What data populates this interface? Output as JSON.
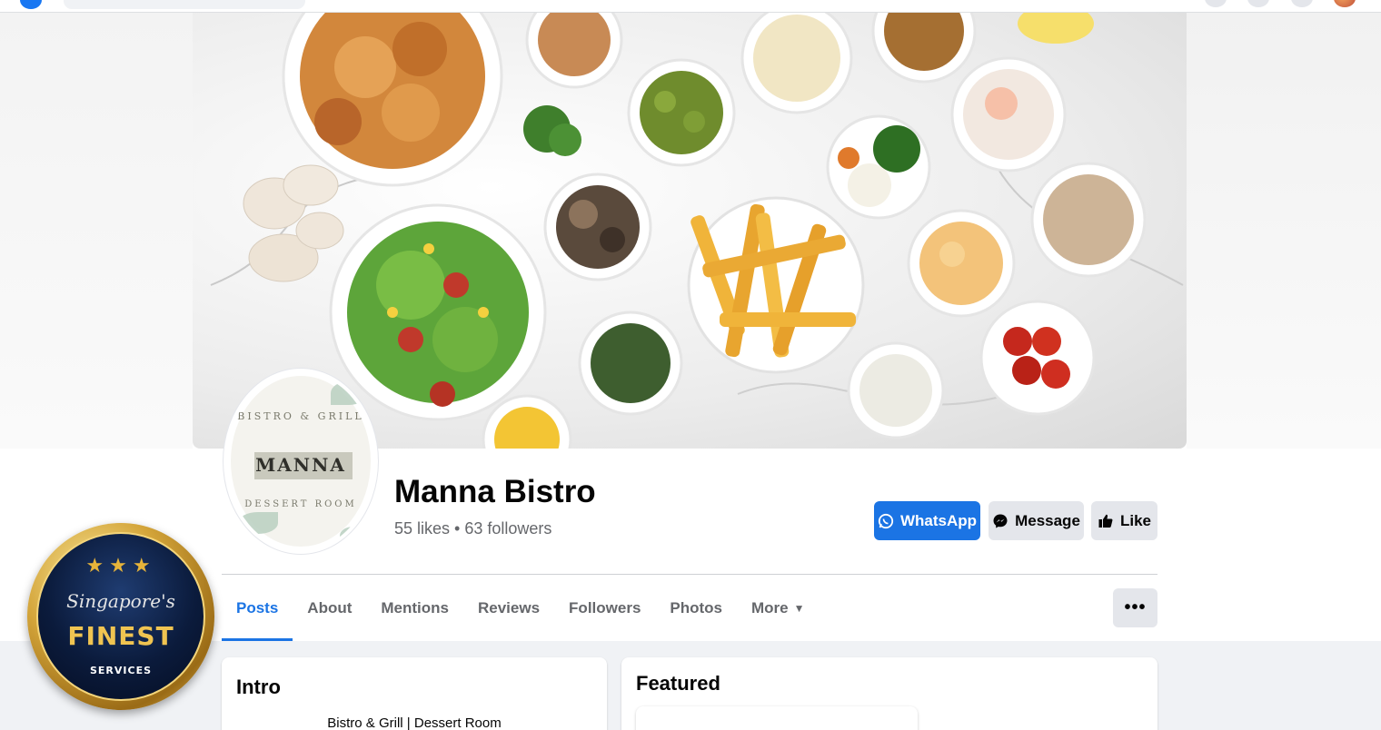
{
  "page": {
    "name": "Manna Bistro",
    "stats": "55 likes • 63 followers"
  },
  "avatar": {
    "ring_top": "BISTRO & GRILL",
    "brand": "MANNA",
    "ring_bottom": "DESSERT ROOM"
  },
  "actions": {
    "whatsapp": "WhatsApp",
    "message": "Message",
    "like": "Like"
  },
  "tabs": [
    {
      "label": "Posts",
      "active": true
    },
    {
      "label": "About",
      "active": false
    },
    {
      "label": "Mentions",
      "active": false
    },
    {
      "label": "Reviews",
      "active": false
    },
    {
      "label": "Followers",
      "active": false
    },
    {
      "label": "Photos",
      "active": false
    },
    {
      "label": "More",
      "active": false
    }
  ],
  "more_menu": "•••",
  "intro": {
    "title": "Intro",
    "description": "Bistro & Grill | Dessert Room"
  },
  "featured": {
    "title": "Featured"
  },
  "badge": {
    "stars": "★★★",
    "line1": "Singapore's",
    "line2": "FINEST",
    "line3": "SERVICES"
  },
  "colors": {
    "accent": "#1b74e4",
    "button_gray": "#e4e6eb",
    "page_bg": "#f0f2f5",
    "badge_gold": "#d4a53a",
    "badge_navy": "#0b1b3c"
  },
  "icons": {
    "whatsapp": "whatsapp-icon",
    "message": "messenger-icon",
    "like": "thumbs-up-icon",
    "more": "caret-down-icon"
  }
}
